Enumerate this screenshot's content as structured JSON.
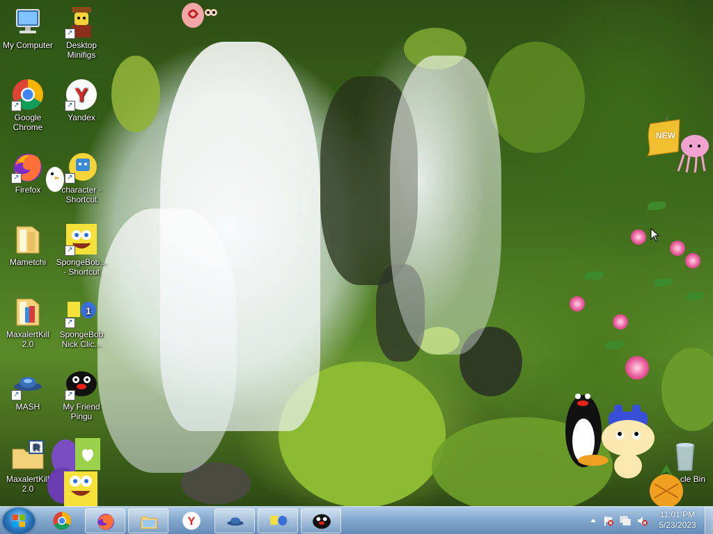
{
  "desktop_icons": [
    {
      "label": "My Computer",
      "shortcut": false
    },
    {
      "label": "Desktop Minifigs",
      "shortcut": true
    },
    {
      "label": "Google Chrome",
      "shortcut": true
    },
    {
      "label": "Yandex",
      "shortcut": true
    },
    {
      "label": "Firefox",
      "shortcut": true
    },
    {
      "label": "character - Shortcut",
      "shortcut": true
    },
    {
      "label": "Mametchi",
      "shortcut": false
    },
    {
      "label": "SpongeBob... - Shortcut",
      "shortcut": true
    },
    {
      "label": "MaxalertKill 2.0",
      "shortcut": false
    },
    {
      "label": "SpongeBob Nick Clic...",
      "shortcut": true
    },
    {
      "label": "MASH",
      "shortcut": true
    },
    {
      "label": "My Friend Pingu",
      "shortcut": true
    },
    {
      "label": "MaxalertKill 2.0",
      "shortcut": false
    },
    {
      "label": "cle Bin",
      "shortcut": false
    }
  ],
  "overlay": {
    "new_sign": "NEW"
  },
  "taskbar": {
    "items": [
      {
        "name": "chrome"
      },
      {
        "name": "firefox"
      },
      {
        "name": "explorer"
      },
      {
        "name": "yandex"
      },
      {
        "name": "mash"
      },
      {
        "name": "spongebob-nick"
      },
      {
        "name": "pingu"
      }
    ],
    "clock_time": "11:01 PM",
    "clock_date": "5/23/2023"
  },
  "colors": {
    "taskbar": "#7aa0c8",
    "accent": "#2f7fc6"
  }
}
